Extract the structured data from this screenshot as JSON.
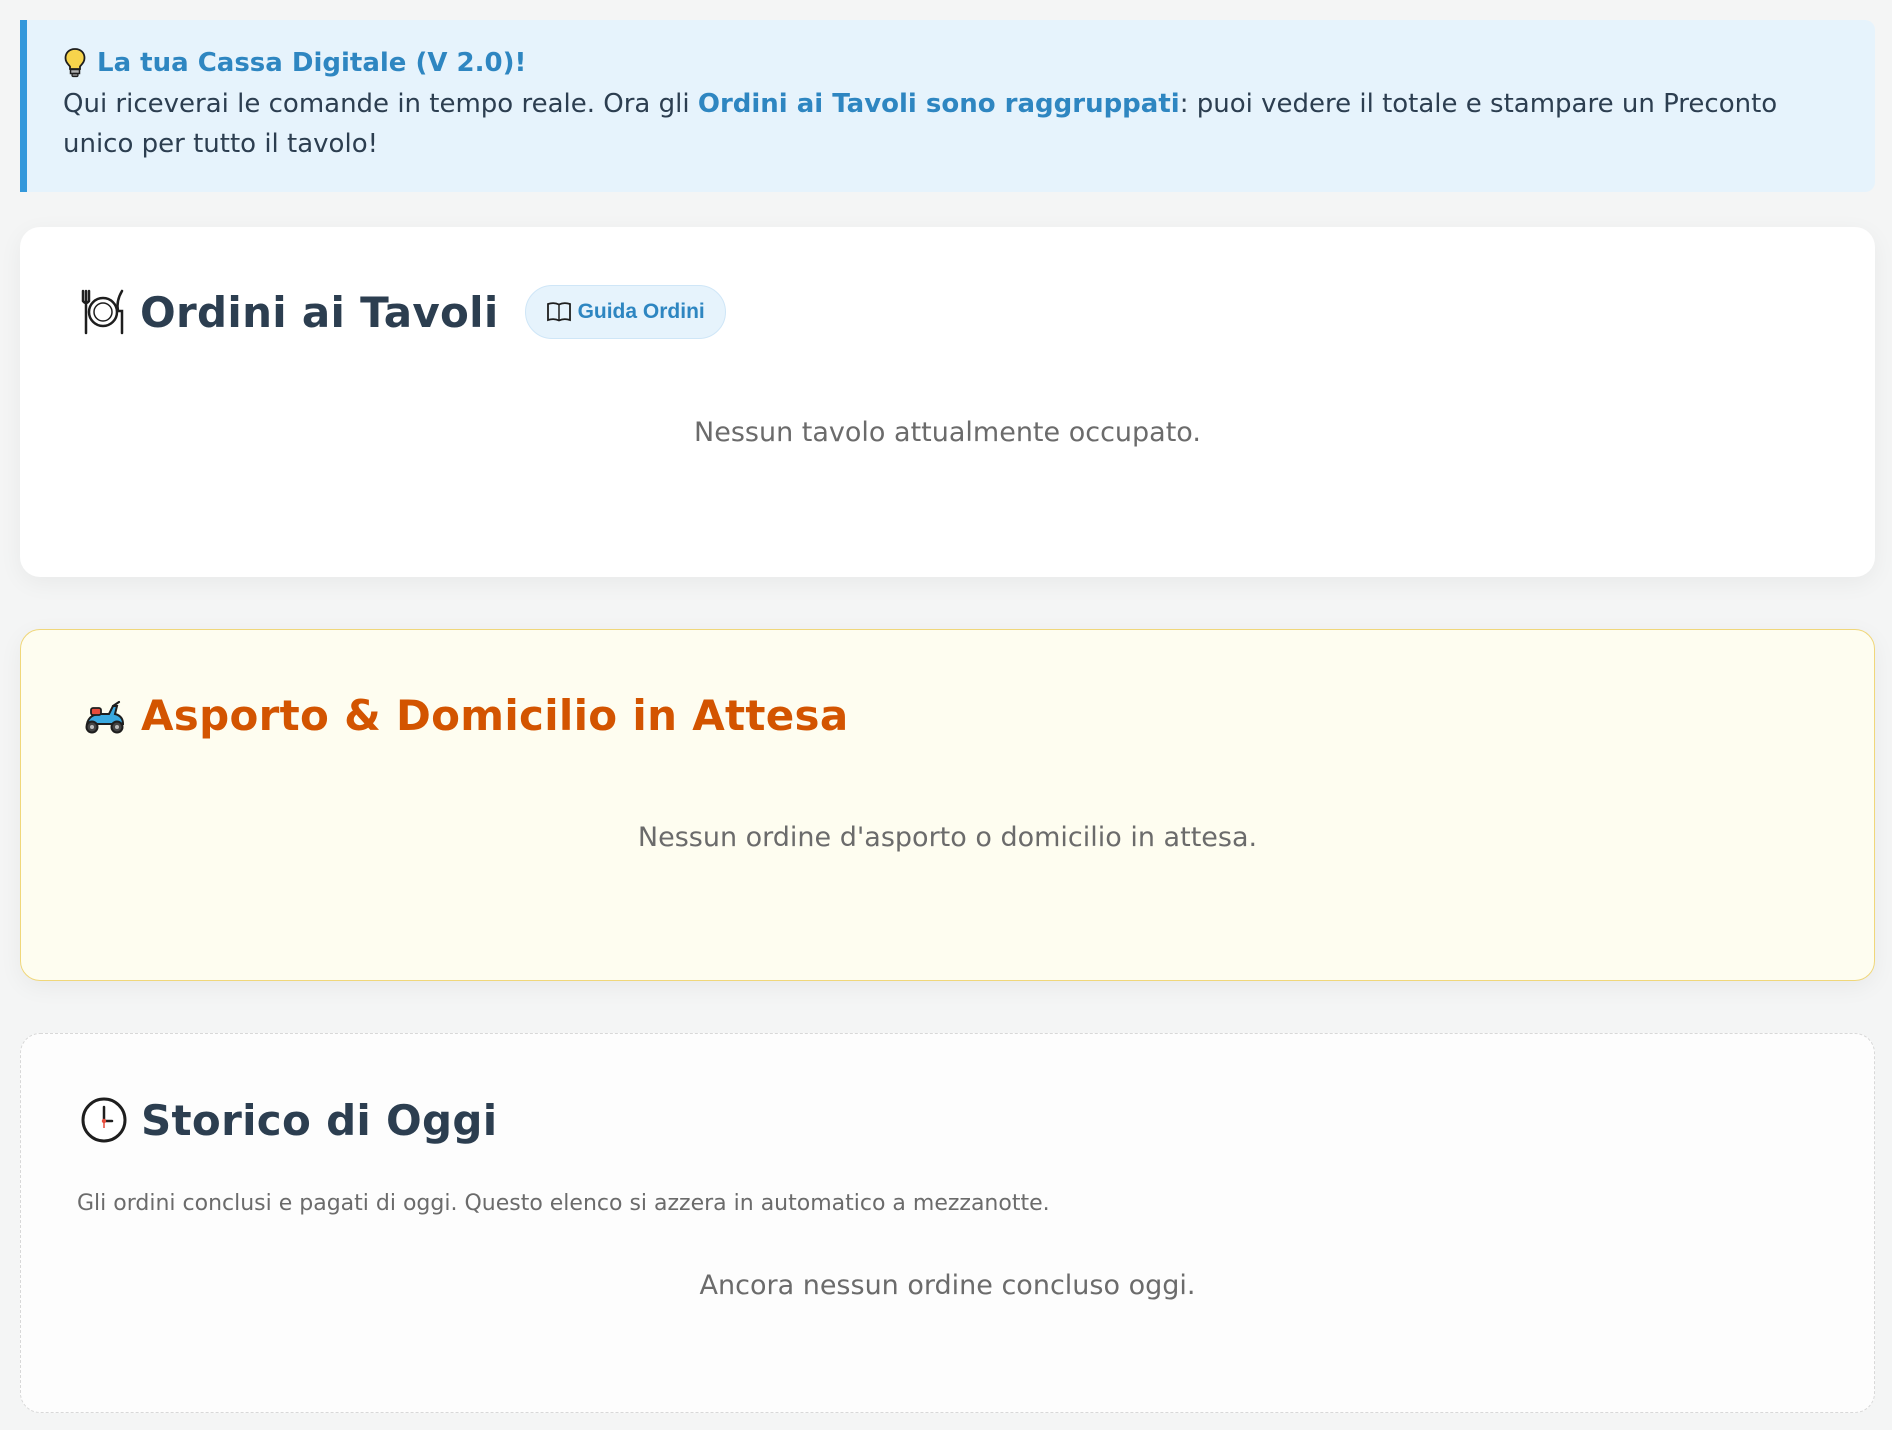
{
  "banner": {
    "title": "La tua Cassa Digitale (V 2.0)!",
    "text_before": "Qui riceverai le comande in tempo reale. Ora gli ",
    "text_highlight": "Ordini ai Tavoli sono raggruppati",
    "text_after": ": puoi vedere il totale e stampare un Preconto unico per tutto il tavolo!",
    "icon": "lightbulb-icon"
  },
  "tables": {
    "title": "Ordini ai Tavoli",
    "icon": "plate-cutlery-icon",
    "guide_button": "Guida Ordini",
    "guide_icon": "book-icon",
    "empty": "Nessun tavolo attualmente occupato."
  },
  "takeaway": {
    "title": "Asporto & Domicilio in Attesa",
    "icon": "scooter-icon",
    "empty": "Nessun ordine d'asporto o domicilio in attesa."
  },
  "history": {
    "title": "Storico di Oggi",
    "icon": "clock-icon",
    "description": "Gli ordini conclusi e pagati di oggi. Questo elenco si azzera in automatico a mezzanotte.",
    "empty": "Ancora nessun ordine concluso oggi."
  },
  "colors": {
    "accent_blue": "#2e86c1",
    "banner_bg": "#e6f3fc",
    "banner_border": "#3498db",
    "takeaway_title": "#d35400",
    "takeaway_bg": "#fefdf0",
    "takeaway_border": "#f0d77a",
    "text_dark": "#2c3e50",
    "text_muted": "#6b6b6b"
  }
}
